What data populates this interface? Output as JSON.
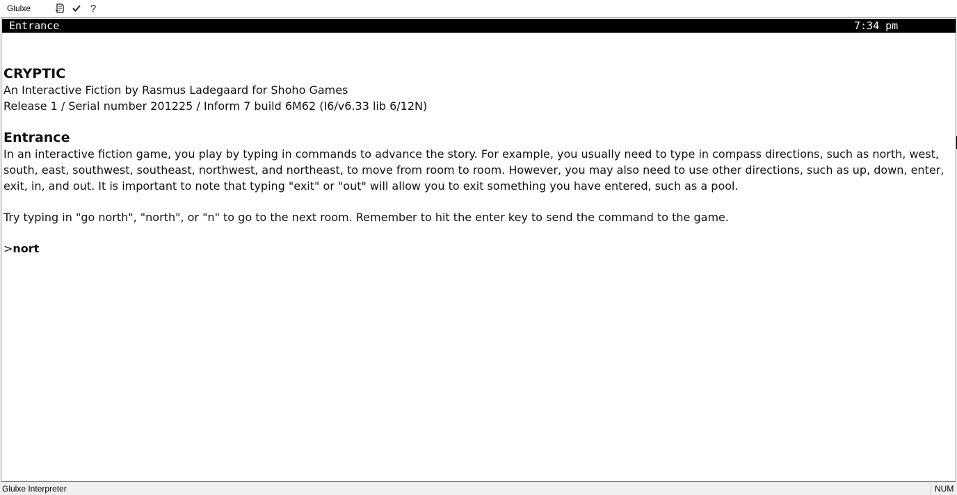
{
  "toolbar": {
    "app_menu": "Glulxe",
    "buttons": [
      {
        "name": "transcript-icon"
      },
      {
        "name": "check-icon"
      },
      {
        "name": "help-icon",
        "glyph": "?"
      }
    ]
  },
  "status_line": {
    "location": "Entrance",
    "time": "7:34 pm"
  },
  "story": {
    "title": "CRYPTIC",
    "byline": "An Interactive Fiction by Rasmus Ladegaard for Shoho Games",
    "release": "Release 1 / Serial number 201225 / Inform 7 build 6M62 (I6/v6.33 lib 6/12N)",
    "room_heading": "Entrance",
    "paragraph1": "In an interactive fiction game, you play by typing in commands to advance the story. For example, you usually need to type in compass directions, such as north, west, south, east, southwest, southeast, northwest, and northeast, to move from room to room. However, you may also need to use other directions, such as up, down, enter, exit, in, and out. It is important to note that typing \"exit\" or \"out\" will allow you to exit something you have entered, such as a pool.",
    "paragraph2": "Try typing in \"go north\", \"north\", or \"n\" to go to the next room. Remember to hit the enter key to send the command to the game.",
    "prompt_symbol": ">",
    "command_input": "nort"
  },
  "statusbar": {
    "text": "Glulxe Interpreter",
    "num_indicator": "NUM"
  },
  "colors": {
    "status_line_bg": "#000000",
    "status_line_fg": "#ffffff",
    "page_bg": "#ffffff"
  }
}
